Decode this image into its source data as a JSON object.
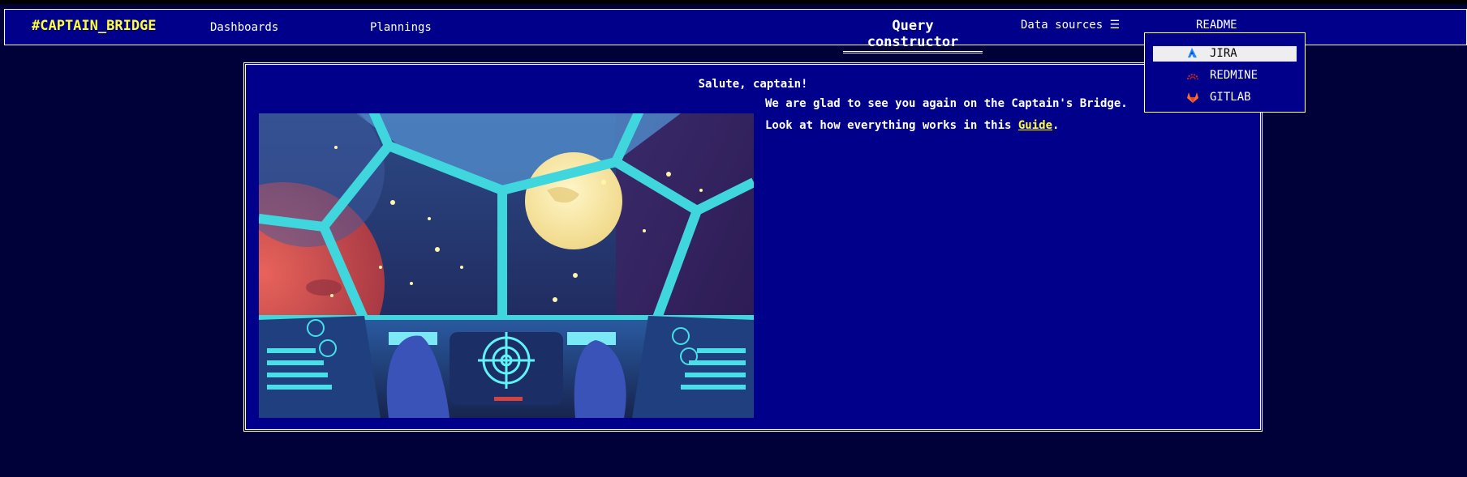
{
  "navbar": {
    "brand": "#CAPTAIN_BRIDGE",
    "links": {
      "dashboards": "Dashboards",
      "plannings": "Plannings",
      "query": "Query constructor",
      "readme": "README"
    },
    "data_sources": {
      "label": "Data sources ☰"
    }
  },
  "dropdown": {
    "items": [
      {
        "label": "JIRA",
        "icon": "jira-icon",
        "active": true
      },
      {
        "label": "REDMINE",
        "icon": "redmine-icon",
        "active": false
      },
      {
        "label": "GITLAB",
        "icon": "gitlab-icon",
        "active": false
      }
    ]
  },
  "welcome": {
    "title": "Salute, captain!",
    "line1": "We are glad to see you again on the Captain's Bridge.",
    "line2_prefix": "Look at how everything works in this ",
    "guide_link": "Guide",
    "line2_suffix": "."
  },
  "colors": {
    "navbar_bg": "#00008b",
    "page_bg": "#01013a",
    "brand": "#ffff33",
    "link_highlight": "#ffff33"
  }
}
